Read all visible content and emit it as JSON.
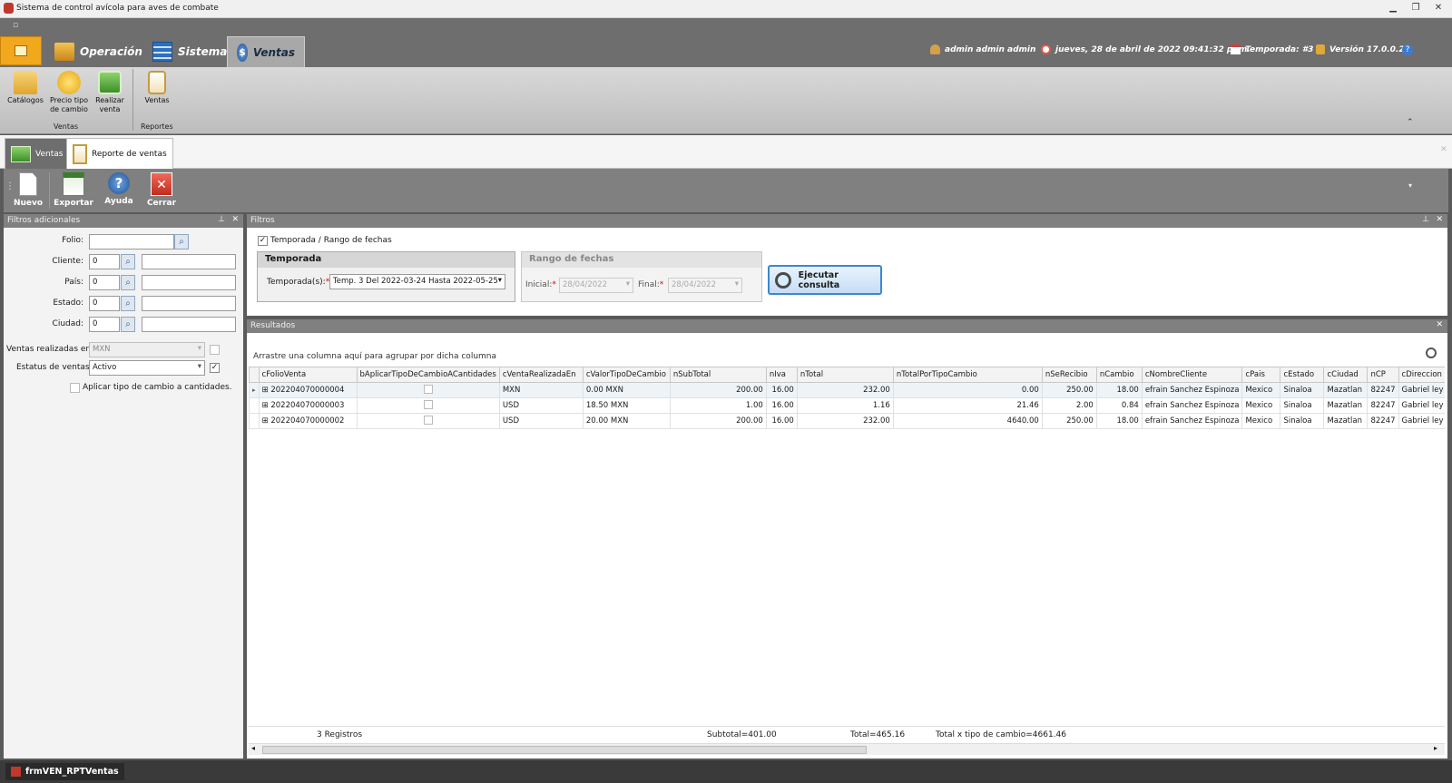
{
  "window": {
    "title": "Sistema de control avícola para aves de combate"
  },
  "ribbon": {
    "tabs": [
      "Operación",
      "Sistema",
      "Ventas"
    ],
    "active_tab": "Ventas",
    "status": {
      "user": "admin admin admin",
      "datetime": "jueves, 28 de abril de 2022 09:41:32 p. m.",
      "season": "Temporada: #3",
      "version": "Versión 17.0.0.2"
    },
    "buttons": [
      {
        "label": "Catálogos",
        "icon": "folder-icon"
      },
      {
        "label": "Precio tipo de cambio",
        "icon": "coins-icon"
      },
      {
        "label": "Realizar venta",
        "icon": "money-icon"
      },
      {
        "label": "Ventas",
        "icon": "clipboard-icon"
      }
    ],
    "groups": [
      "Ventas",
      "Reportes"
    ]
  },
  "doc_tabs": [
    "Ventas",
    "Reporte de ventas"
  ],
  "toolbar": {
    "new": "Nuevo",
    "export": "Exportar",
    "help": "Ayuda",
    "close": "Cerrar"
  },
  "left_panel": {
    "title": "Filtros adicionales",
    "folio_label": "Folio:",
    "cliente_label": "Cliente:",
    "pais_label": "País:",
    "estado_label": "Estado:",
    "ciudad_label": "Ciudad:",
    "cliente_value": "0",
    "pais_value": "0",
    "estado_value": "0",
    "ciudad_value": "0",
    "ventas_en_label": "Ventas realizadas en:",
    "ventas_en_value": "MXN",
    "estatus_label": "Estatus de ventas:",
    "estatus_value": "Activo",
    "aplicar_label": "Aplicar tipo de cambio a cantidades."
  },
  "filters": {
    "title": "Filtros",
    "checkbox_label": "Temporada / Rango de fechas",
    "temporada_group": "Temporada",
    "temporada_label": "Temporada(s):",
    "temporada_value": "Temp. 3 Del 2022-03-24 Hasta 2022-05-25",
    "rango_group": "Rango de fechas",
    "inicial_label": "Inicial:",
    "inicial_value": "28/04/2022",
    "final_label": "Final:",
    "final_value": "28/04/2022",
    "run_button": "Ejecutar consulta",
    "required_mark": "*"
  },
  "results": {
    "title": "Resultados",
    "group_hint": "Arrastre una columna aquí para agrupar por dicha columna",
    "columns": [
      "cFolioVenta",
      "bAplicarTipoDeCambioACantidades",
      "cVentaRealizadaEn",
      "cValorTipoDeCambio",
      "nSubTotal",
      "nIva",
      "nTotal",
      "nTotalPorTipoCambio",
      "nSeRecibio",
      "nCambio",
      "cNombreCliente",
      "cPais",
      "cEstado",
      "cCiudad",
      "nCP",
      "cDireccion"
    ],
    "rows": [
      [
        "202204070000004",
        "",
        "MXN",
        "0.00 MXN",
        "200.00",
        "16.00",
        "232.00",
        "0.00",
        "250.00",
        "18.00",
        "efrain  Sanchez Espinoza",
        "Mexico",
        "Sinaloa",
        "Mazatlan",
        "82247",
        "Gabriel ley"
      ],
      [
        "202204070000003",
        "",
        "USD",
        "18.50 MXN",
        "1.00",
        "16.00",
        "1.16",
        "21.46",
        "2.00",
        "0.84",
        "efrain  Sanchez Espinoza",
        "Mexico",
        "Sinaloa",
        "Mazatlan",
        "82247",
        "Gabriel ley"
      ],
      [
        "202204070000002",
        "",
        "USD",
        "20.00 MXN",
        "200.00",
        "16.00",
        "232.00",
        "4640.00",
        "250.00",
        "18.00",
        "efrain  Sanchez Espinoza",
        "Mexico",
        "Sinaloa",
        "Mazatlan",
        "82247",
        "Gabriel ley"
      ]
    ],
    "footer": {
      "count": "3 Registros",
      "subtotal": "Subtotal=401.00",
      "total": "Total=465.16",
      "total_tc": "Total x tipo de cambio=4661.46"
    }
  },
  "statusbar": {
    "form": "frmVEN_RPTVentas"
  },
  "colors": {
    "accent": "#f2a81d",
    "ribbon_dark": "#6e6e6e",
    "panel_header": "#808080"
  }
}
